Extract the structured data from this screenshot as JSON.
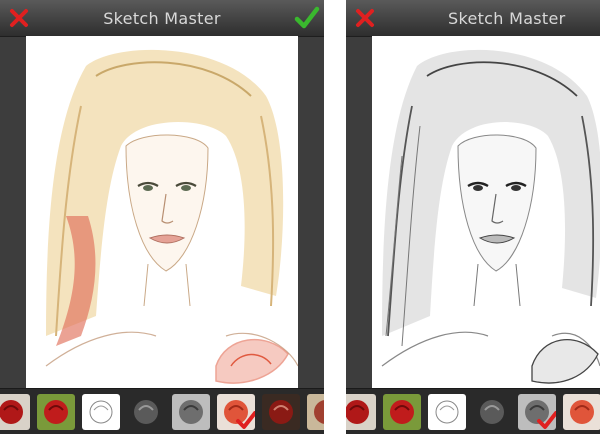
{
  "app": {
    "title": "Sketch Master"
  },
  "screens": [
    {
      "title": "Sketch Master",
      "style": "color-sketch",
      "selected_filter": 5
    },
    {
      "title": "Sketch Master",
      "style": "pencil-sketch",
      "selected_filter": 4
    }
  ],
  "filters": [
    {
      "name": "color-rose",
      "icon": "red-rose"
    },
    {
      "name": "color-rose-green",
      "icon": "red-rose-green-bg"
    },
    {
      "name": "outline-sketch",
      "icon": "rose-outline"
    },
    {
      "name": "dark-pencil",
      "icon": "gray-rose-dark"
    },
    {
      "name": "gray-pencil",
      "icon": "gray-rose"
    },
    {
      "name": "color-pencil",
      "icon": "orange-rose"
    },
    {
      "name": "dark-color",
      "icon": "deep-red-rose"
    }
  ],
  "colors": {
    "cancel": "#e02020",
    "confirm": "#3ab82e",
    "bar": "#3d3d3d",
    "title_text": "#d8d8d8"
  },
  "icons": {
    "cancel": "close-x-icon",
    "confirm": "checkmark-icon",
    "selected": "selected-check-icon"
  }
}
